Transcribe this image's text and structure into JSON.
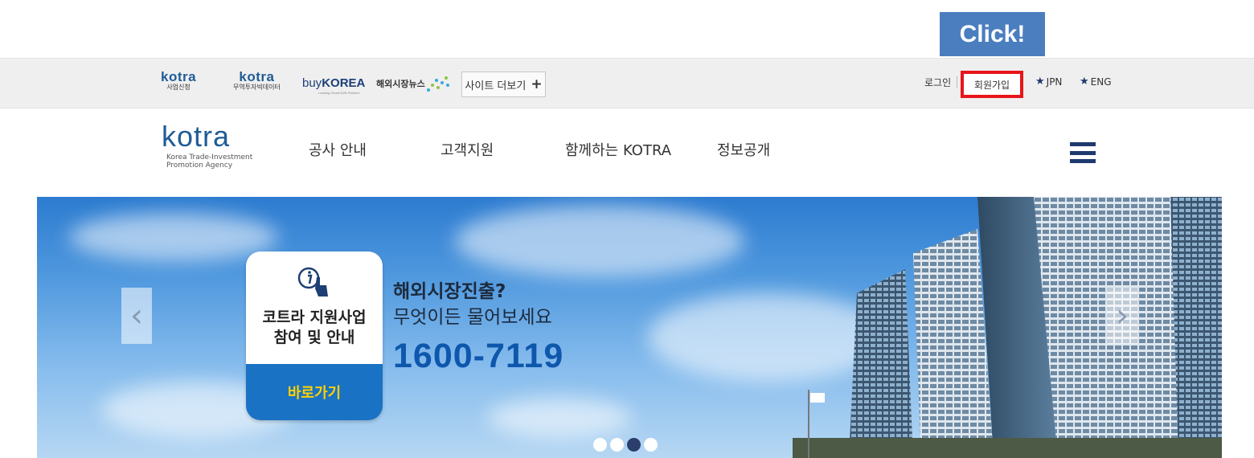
{
  "callout": {
    "label": "Click!"
  },
  "topbar": {
    "logos": [
      {
        "word": "kotra",
        "sub": "사업신청"
      },
      {
        "word": "kotra",
        "sub": "무역투자빅데이터"
      }
    ],
    "buykorea": {
      "prefix": "buy",
      "main": "KOREA",
      "tagline": "Leading Global B2B Platform"
    },
    "news_label": "해외시장뉴스",
    "more_label": "사이트 더보기",
    "more_plus": "+",
    "login": "로그인",
    "signup": "회원가입",
    "lang_jpn": "JPN",
    "lang_eng": "ENG"
  },
  "nav": {
    "brand_word": "kotra",
    "brand_line1": "Korea Trade-Investment",
    "brand_line2": "Promotion Agency",
    "items": [
      "공사 안내",
      "고객지원",
      "함께하는 KOTRA",
      "정보공개"
    ]
  },
  "banner": {
    "card_line1": "코트라 지원사업",
    "card_line2": "참여 및 안내",
    "card_button": "바로가기",
    "question": "해외시장진출?",
    "ask": "무엇이든 물어보세요",
    "phone": "1600-7119",
    "active_slide": 3,
    "slide_count": 4
  }
}
